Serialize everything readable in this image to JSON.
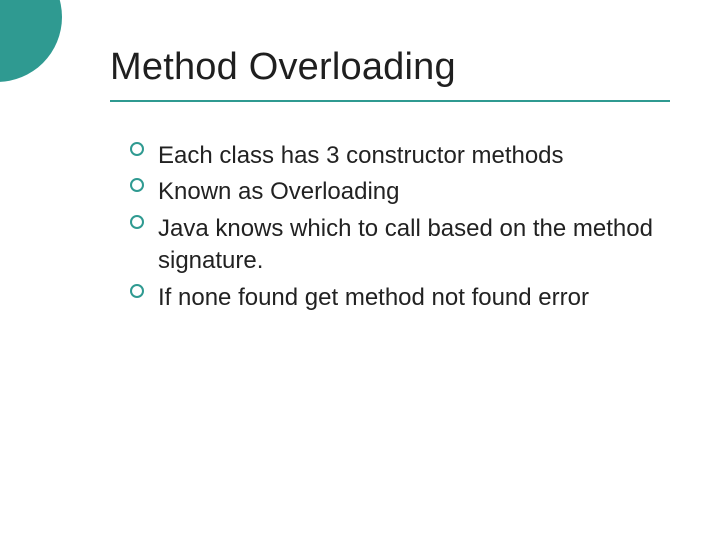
{
  "slide": {
    "title": "Method Overloading",
    "bullets": [
      "Each class has 3 constructor methods",
      "Known as Overloading",
      "Java knows which to call based on the method signature.",
      "If none found get method not found error"
    ]
  }
}
